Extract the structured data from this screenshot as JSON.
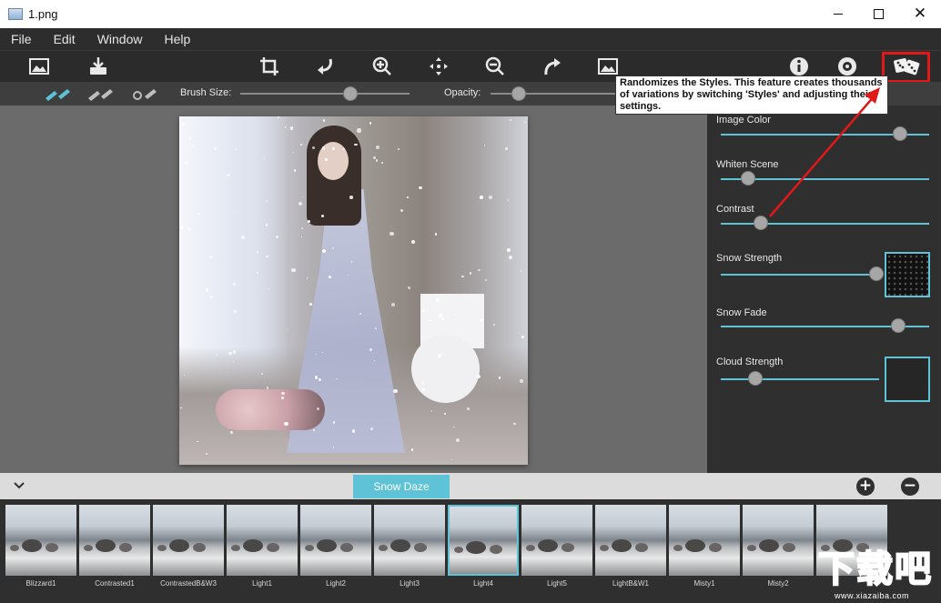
{
  "window": {
    "title": "1.png"
  },
  "menu": [
    "File",
    "Edit",
    "Window",
    "Help"
  ],
  "brush": {
    "size_label": "Brush Size:",
    "opacity_label": "Opacity:",
    "size_value": 0.65,
    "opacity_value": 0.22
  },
  "tooltip": {
    "text": "Randomizes the Styles. This feature creates thousands of variations by switching 'Styles' and adjusting their settings."
  },
  "params": [
    {
      "label": "Image Color",
      "value": 0.86
    },
    {
      "label": "Whiten Scene",
      "value": 0.13
    },
    {
      "label": "Contrast",
      "value": 0.19
    },
    {
      "label": "Snow Strength",
      "value": 0.98
    },
    {
      "label": "Snow Fade",
      "value": 0.85
    },
    {
      "label": "Cloud Strength",
      "value": 0.22
    }
  ],
  "current_style": "Snow Daze",
  "styles": [
    "Blizzard1",
    "Contrasted1",
    "ContrastedB&W3",
    "Light1",
    "Light2",
    "Light3",
    "Light4",
    "Light5",
    "LightB&W1",
    "Misty1",
    "Misty2",
    ""
  ],
  "selected_style": "Light4",
  "colors": {
    "accent": "#5ec3d6",
    "highlight": "#e01818",
    "panel": "#2f2f2f"
  },
  "watermark": {
    "glyphs": "下载吧",
    "url": "www.xiazaiba.com"
  }
}
